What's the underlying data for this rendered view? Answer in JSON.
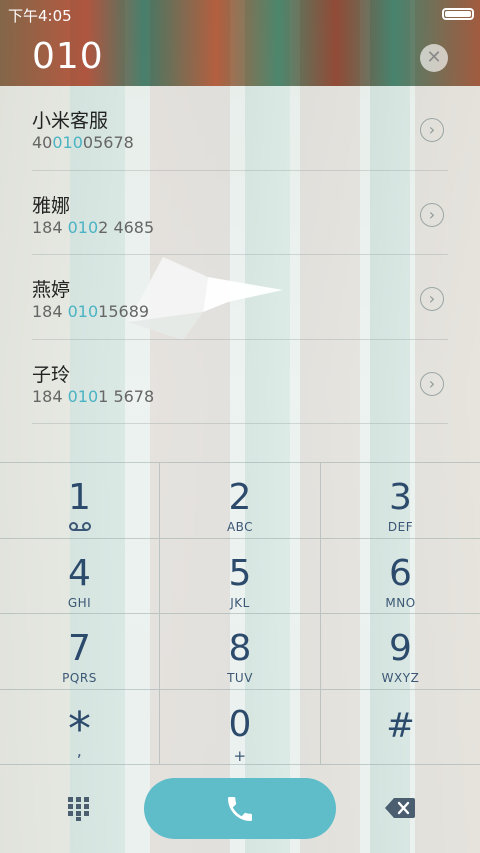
{
  "status_bar": {
    "time": "下午4:05"
  },
  "dialer": {
    "number": "010",
    "clear_symbol": "✕"
  },
  "results": [
    {
      "name": "小米客服",
      "number_prefix": "40",
      "number_match": "010",
      "number_suffix": "05678"
    },
    {
      "name": "雅娜",
      "number_prefix": "184 ",
      "number_match": "010",
      "number_suffix": "2 4685"
    },
    {
      "name": "燕婷",
      "number_prefix": "184 ",
      "number_match": "010",
      "number_suffix": "15689"
    },
    {
      "name": "子玲",
      "number_prefix": "184 ",
      "number_match": "010",
      "number_suffix": "1 5678"
    }
  ],
  "keypad": {
    "keys": [
      {
        "digit": "1",
        "sub": ""
      },
      {
        "digit": "2",
        "sub": "ABC"
      },
      {
        "digit": "3",
        "sub": "DEF"
      },
      {
        "digit": "4",
        "sub": "GHI"
      },
      {
        "digit": "5",
        "sub": "JKL"
      },
      {
        "digit": "6",
        "sub": "MNO"
      },
      {
        "digit": "7",
        "sub": "PQRS"
      },
      {
        "digit": "8",
        "sub": "TUV"
      },
      {
        "digit": "9",
        "sub": "WXYZ"
      },
      {
        "digit": "*",
        "sub": ","
      },
      {
        "digit": "0",
        "sub": "+"
      },
      {
        "digit": "#",
        "sub": ""
      }
    ]
  },
  "colors": {
    "accent": "#5fbcc9",
    "highlight": "#4ab3c4",
    "key_text": "#2c4a6c"
  },
  "icons": {
    "key1": "voicemail-icon",
    "bottom_left": "dialpad-icon",
    "call": "phone-icon",
    "bottom_right": "backspace-icon"
  }
}
